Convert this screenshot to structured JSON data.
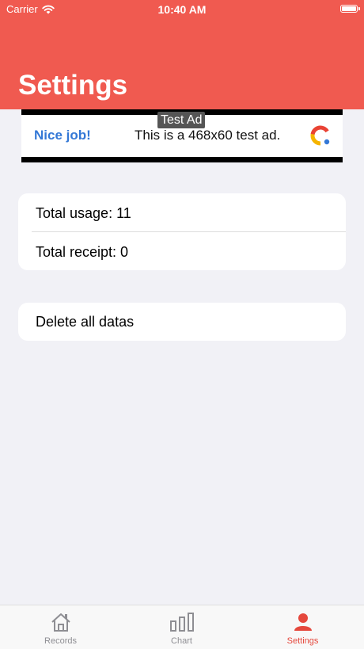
{
  "status_bar": {
    "carrier": "Carrier",
    "time": "10:40 AM"
  },
  "header": {
    "title": "Settings",
    "color": "#f05a50"
  },
  "ad": {
    "badge": "Test Ad",
    "left_text": "Nice job!",
    "body_text": "This is a 468x60 test ad."
  },
  "stats": {
    "total_usage": "Total usage: 11",
    "total_receipt": "Total receipt: 0"
  },
  "actions": {
    "delete_all": "Delete all datas"
  },
  "tabbar": {
    "items": [
      {
        "label": "Records",
        "icon": "house-icon"
      },
      {
        "label": "Chart",
        "icon": "bar-chart-icon"
      },
      {
        "label": "Settings",
        "icon": "person-icon"
      }
    ],
    "active_index": 2,
    "active_color": "#e5483d"
  }
}
